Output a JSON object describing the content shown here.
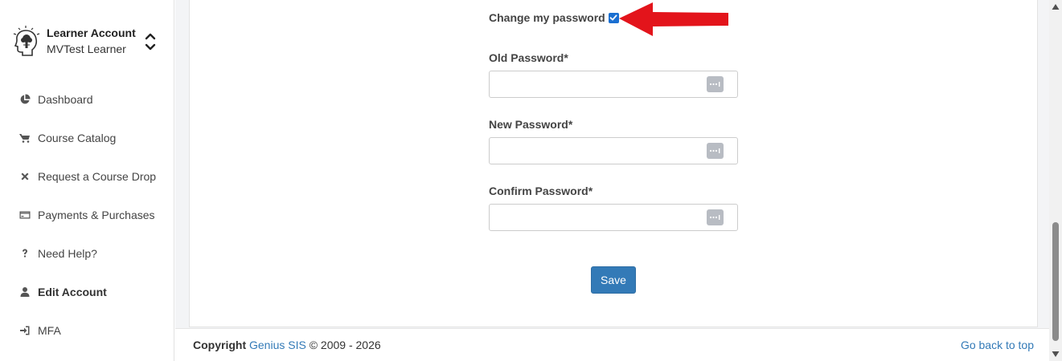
{
  "account": {
    "title": "Learner Account",
    "subtitle": "MVTest Learner",
    "logo_icon": "learner-head-icon",
    "toggle_icon": "chevron-up-down-icon"
  },
  "sidebar": {
    "items": [
      {
        "label": "Dashboard",
        "icon": "pie-chart-icon",
        "active": false
      },
      {
        "label": "Course Catalog",
        "icon": "cart-icon",
        "active": false
      },
      {
        "label": "Request a Course Drop",
        "icon": "close-icon",
        "active": false
      },
      {
        "label": "Payments & Purchases",
        "icon": "credit-card-icon",
        "active": false
      },
      {
        "label": "Need Help?",
        "icon": "question-icon",
        "active": false
      },
      {
        "label": "Edit Account",
        "icon": "user-icon",
        "active": true
      },
      {
        "label": "MFA",
        "icon": "sign-in-icon",
        "active": false
      }
    ]
  },
  "form": {
    "change_password_label": "Change my password",
    "change_password_checked": true,
    "old_password_label": "Old Password*",
    "old_password_value": "",
    "new_password_label": "New Password*",
    "new_password_value": "",
    "confirm_password_label": "Confirm Password*",
    "confirm_password_value": "",
    "password_icon": "password-dots-icon",
    "save_label": "Save"
  },
  "annotation": {
    "arrow_icon": "red-arrow-icon",
    "arrow_color": "#e3141b"
  },
  "footer": {
    "copyright_label": "Copyright",
    "brand_link": "Genius SIS",
    "years": "© 2009 - 2026",
    "back_to_top": "Go back to top"
  },
  "colors": {
    "accent": "#337ab7",
    "checkbox": "#1a6fd1",
    "page_background": "#f3f4f6"
  }
}
